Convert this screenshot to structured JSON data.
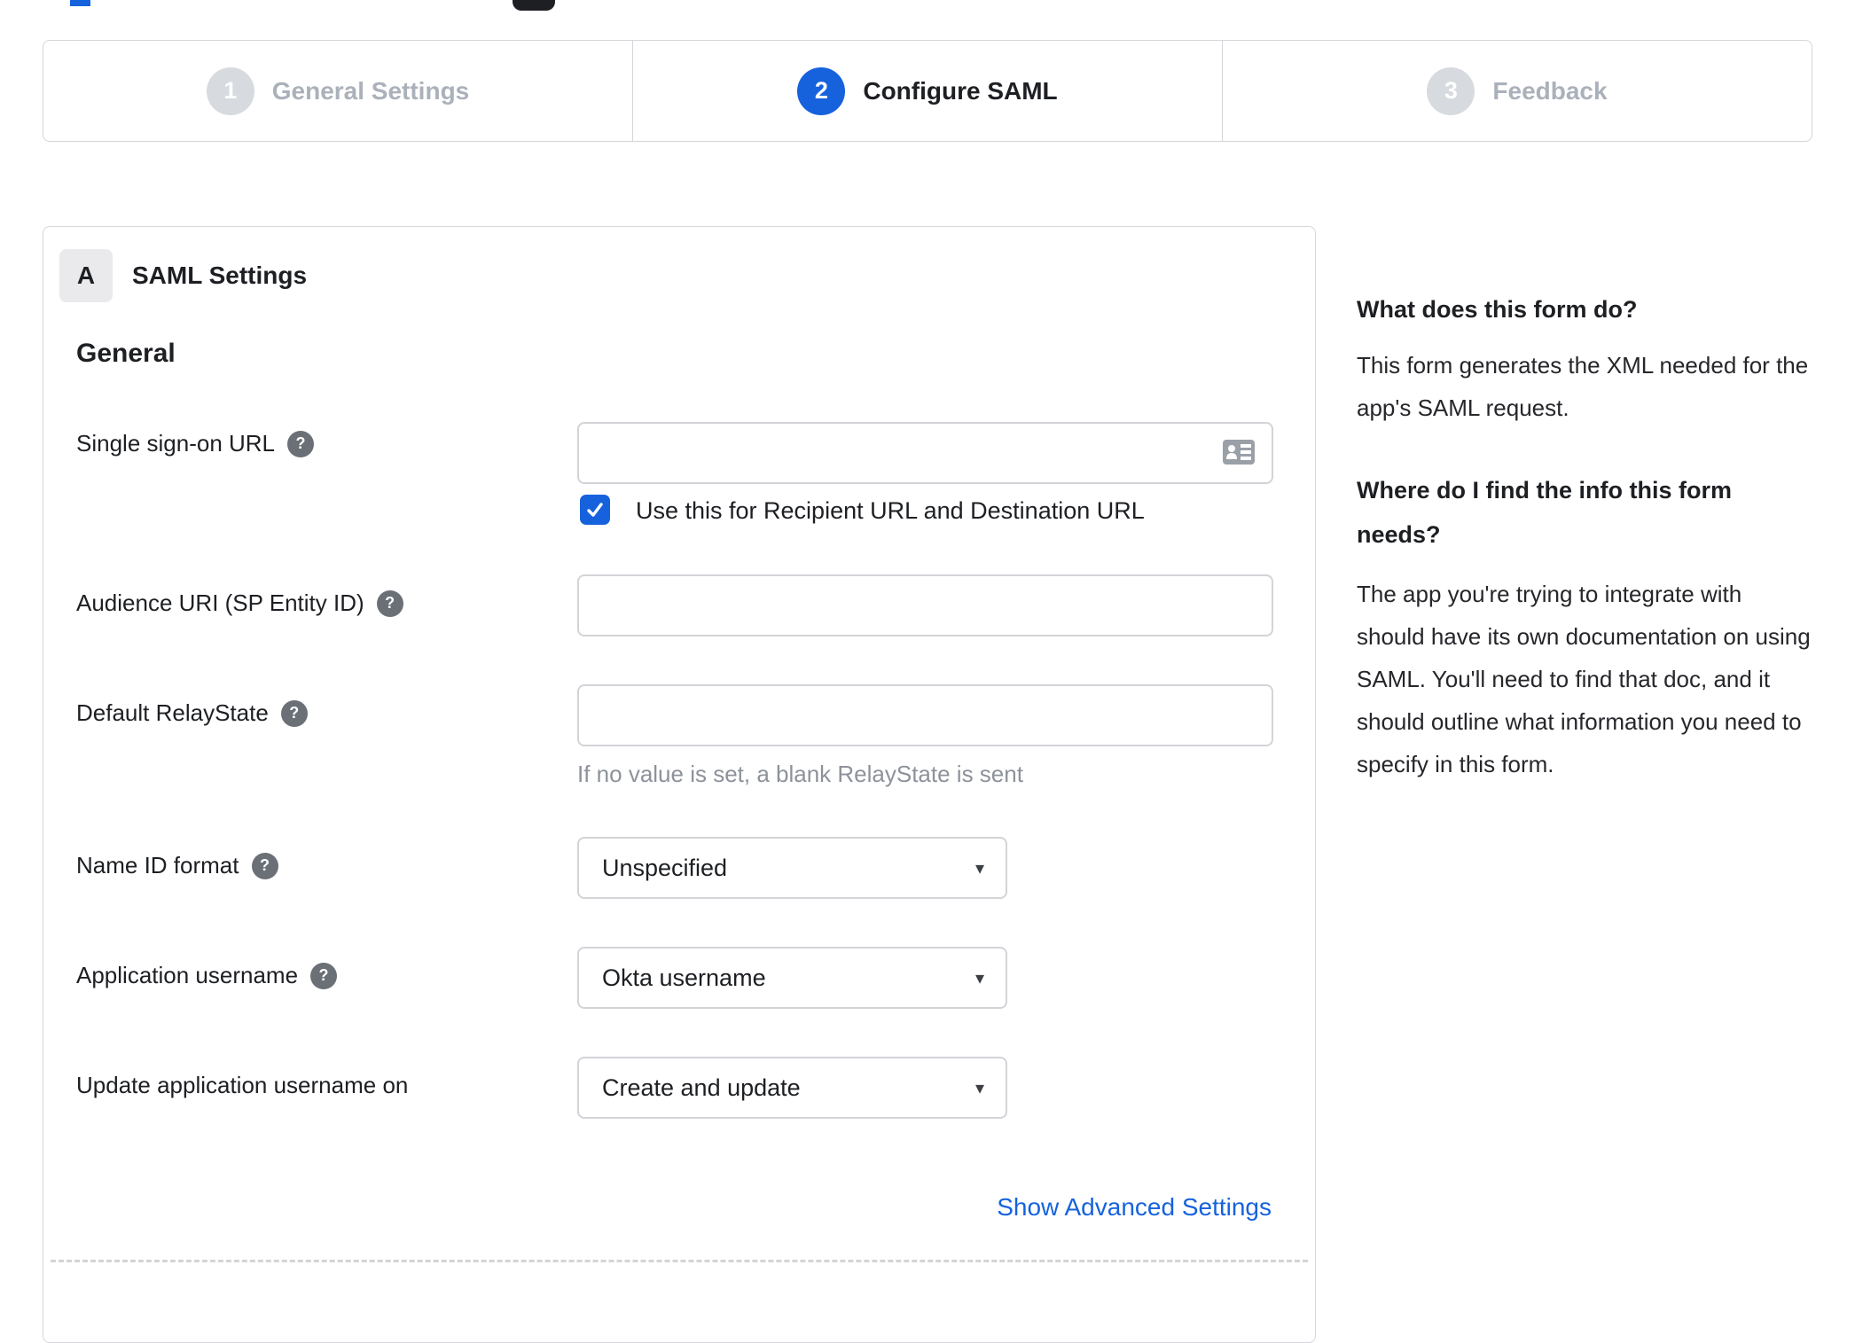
{
  "stepper": {
    "steps": [
      {
        "number": "1",
        "label": "General Settings"
      },
      {
        "number": "2",
        "label": "Configure SAML"
      },
      {
        "number": "3",
        "label": "Feedback"
      }
    ]
  },
  "panel": {
    "badge": "A",
    "title": "SAML Settings",
    "section": "General",
    "sso": {
      "label": "Single sign-on URL",
      "value": ""
    },
    "sso_checkbox_label": "Use this for Recipient URL and Destination URL",
    "audience": {
      "label": "Audience URI (SP Entity ID)",
      "value": ""
    },
    "relaystate": {
      "label": "Default RelayState",
      "value": "",
      "hint": "If no value is set, a blank RelayState is sent"
    },
    "name_id": {
      "label": "Name ID format",
      "value": "Unspecified"
    },
    "app_username": {
      "label": "Application username",
      "value": "Okta username"
    },
    "update_username": {
      "label": "Update application username on",
      "value": "Create and update"
    },
    "advanced_link": "Show Advanced Settings"
  },
  "sidebar": {
    "q1": "What does this form do?",
    "a1": "This form generates the XML needed for the app's SAML request.",
    "q2": "Where do I find the info this form needs?",
    "a2": "The app you're trying to integrate with should have its own documentation on using SAML. You'll need to find that doc, and it should outline what information you need to specify in this form."
  },
  "icons": {
    "help": "?",
    "check": "✓",
    "dropdown_arrow": "▾"
  },
  "colors": {
    "accent_blue": "#1662dd",
    "inactive_gray": "#abb1ba"
  }
}
